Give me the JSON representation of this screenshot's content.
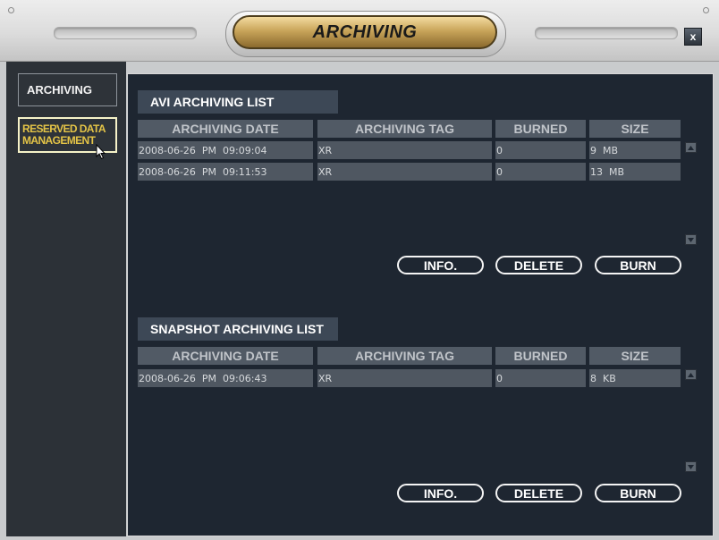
{
  "window": {
    "title": "ARCHIVING",
    "close_label": "x"
  },
  "sidebar": {
    "items": [
      {
        "label": "ARCHIVING"
      },
      {
        "label_line1": "RESERVED DATA",
        "label_line2": "MANAGEMENT"
      }
    ]
  },
  "avi_list": {
    "title": "AVI ARCHIVING LIST",
    "columns": [
      "ARCHIVING DATE",
      "ARCHIVING TAG",
      "BURNED",
      "SIZE"
    ],
    "rows": [
      [
        "2008-06-26  PM  09:09:04",
        "XR",
        "0",
        "9  MB"
      ],
      [
        "2008-06-26  PM  09:11:53",
        "XR",
        "0",
        "13  MB"
      ]
    ],
    "buttons": {
      "info": "INFO.",
      "delete": "DELETE",
      "burn": "BURN"
    }
  },
  "snapshot_list": {
    "title": "SNAPSHOT ARCHIVING LIST",
    "columns": [
      "ARCHIVING DATE",
      "ARCHIVING TAG",
      "BURNED",
      "SIZE"
    ],
    "rows": [
      [
        "2008-06-26  PM  09:06:43",
        "XR",
        "0",
        "8  KB"
      ]
    ],
    "buttons": {
      "info": "INFO.",
      "delete": "DELETE",
      "burn": "BURN"
    }
  },
  "colors": {
    "panel_bg": "#1e2631",
    "sidebar_bg": "#2c3137",
    "title_gold": "#c9a55a",
    "highlight_text": "#e4c447"
  }
}
